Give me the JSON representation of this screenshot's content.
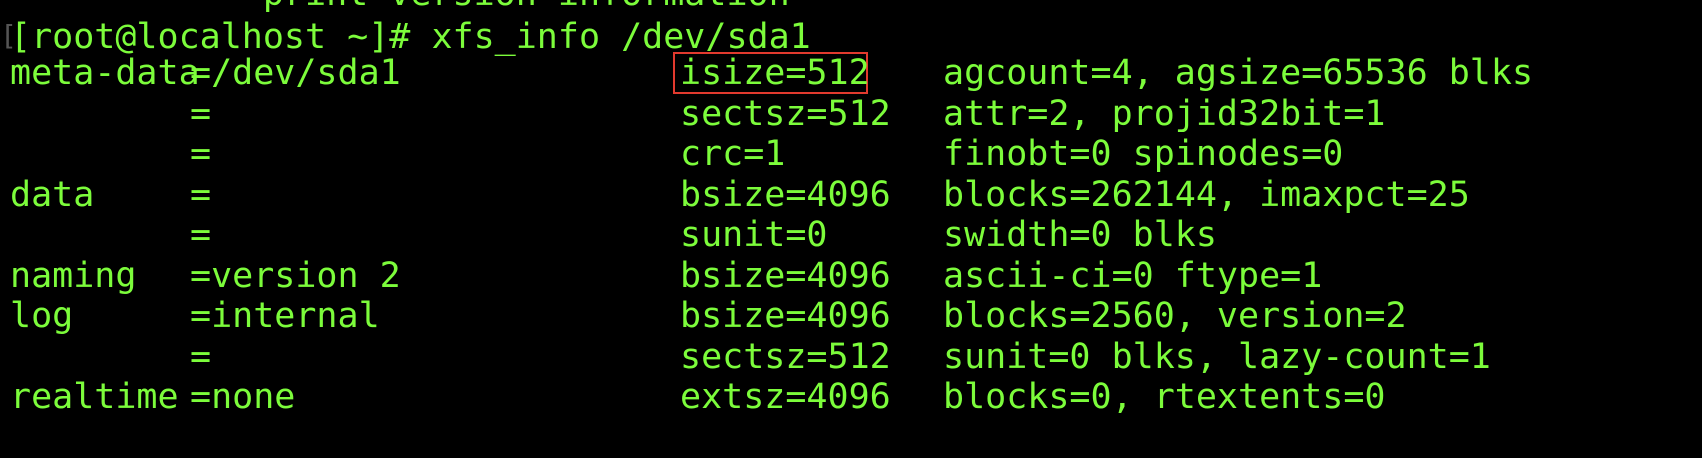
{
  "terminal": {
    "clipped_top_line": "            print version information",
    "prompt": "[root@localhost ~]# ",
    "command": "xfs_info /dev/sda1",
    "rows": [
      {
        "c1": "meta-data",
        "c2": "=/dev/sda1",
        "c3": "isize=512",
        "c4": "agcount=4, agsize=65536 blks"
      },
      {
        "c1": "",
        "c2": "=",
        "c3": "sectsz=512",
        "c4": "attr=2, projid32bit=1"
      },
      {
        "c1": "",
        "c2": "=",
        "c3": "crc=1",
        "c4": "finobt=0 spinodes=0"
      },
      {
        "c1": "data",
        "c2": "=",
        "c3": "bsize=4096",
        "c4": "blocks=262144, imaxpct=25"
      },
      {
        "c1": "",
        "c2": "=",
        "c3": "sunit=0",
        "c4": "swidth=0 blks"
      },
      {
        "c1": "naming",
        "c2": "=version 2",
        "c3": "bsize=4096",
        "c4": "ascii-ci=0 ftype=1"
      },
      {
        "c1": "log",
        "c2": "=internal",
        "c3": "bsize=4096",
        "c4": "blocks=2560, version=2"
      },
      {
        "c1": "",
        "c2": "=",
        "c3": "sectsz=512",
        "c4": "sunit=0 blks, lazy-count=1"
      },
      {
        "c1": "realtime",
        "c2": "=none",
        "c3": "extsz=4096",
        "c4": "blocks=0, rtextents=0"
      }
    ]
  },
  "colors": {
    "text": "#7CFC3B",
    "background": "#000000",
    "highlight_border": "#E23A2E"
  }
}
